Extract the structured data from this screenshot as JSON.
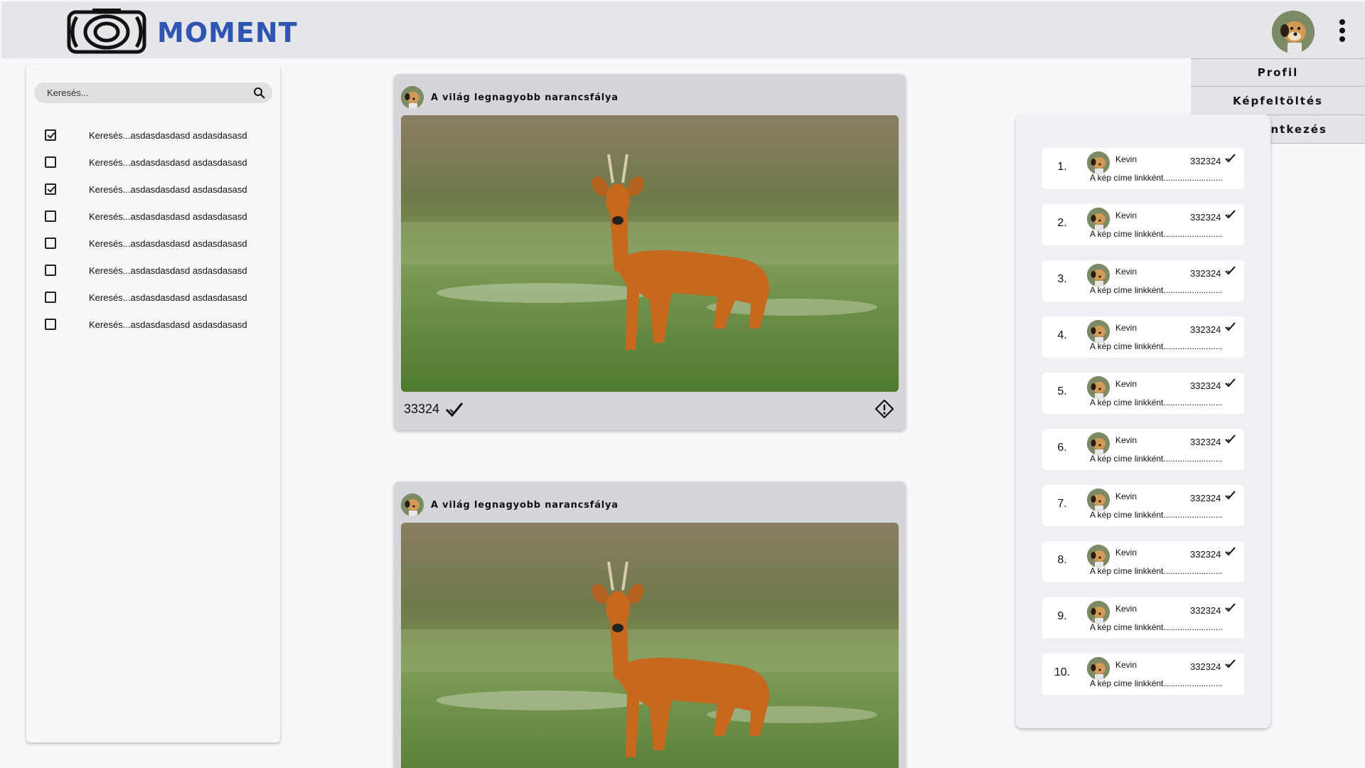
{
  "app": {
    "name": "MOMENT"
  },
  "colors": {
    "brand": "#2f55b0",
    "header_bg": "#e5e6e9",
    "card_bg": "#d4d6da"
  },
  "menu": {
    "items": [
      {
        "label": "Profil"
      },
      {
        "label": "Képfeltöltés"
      },
      {
        "label": "Kijelentkezés"
      }
    ]
  },
  "sidebar": {
    "search": {
      "placeholder": "Keresés..."
    },
    "filters": [
      {
        "label": "Keresés...asdasdasdasd asdasdasasd",
        "checked": true
      },
      {
        "label": "Keresés...asdasdasdasd asdasdasasd",
        "checked": false
      },
      {
        "label": "Keresés...asdasdasdasd asdasdasasd",
        "checked": true
      },
      {
        "label": "Keresés...asdasdasdasd asdasdasasd",
        "checked": false
      },
      {
        "label": "Keresés...asdasdasdasd asdasdasasd",
        "checked": false
      },
      {
        "label": "Keresés...asdasdasdasd asdasdasasd",
        "checked": false
      },
      {
        "label": "Keresés...asdasdasdasd asdasdasasd",
        "checked": false
      },
      {
        "label": "Keresés...asdasdasdasd asdasdasasd",
        "checked": false
      }
    ]
  },
  "posts": [
    {
      "title": "A világ legnagyobb narancsfálya",
      "count": "33324"
    },
    {
      "title": "A világ legnagyobb narancsfálya",
      "count": ""
    }
  ],
  "leaderboard": {
    "entries": [
      {
        "rank": "1.",
        "name": "Kevin",
        "score": "332324",
        "caption": "A kép címe linkként........................."
      },
      {
        "rank": "2.",
        "name": "Kevin",
        "score": "332324",
        "caption": "A kép címe linkként........................."
      },
      {
        "rank": "3.",
        "name": "Kevin",
        "score": "332324",
        "caption": "A kép címe linkként........................."
      },
      {
        "rank": "4.",
        "name": "Kevin",
        "score": "332324",
        "caption": "A kép címe linkként........................."
      },
      {
        "rank": "5.",
        "name": "Kevin",
        "score": "332324",
        "caption": "A kép címe linkként........................."
      },
      {
        "rank": "6.",
        "name": "Kevin",
        "score": "332324",
        "caption": "A kép címe linkként........................."
      },
      {
        "rank": "7.",
        "name": "Kevin",
        "score": "332324",
        "caption": "A kép címe linkként........................."
      },
      {
        "rank": "8.",
        "name": "Kevin",
        "score": "332324",
        "caption": "A kép címe linkként........................."
      },
      {
        "rank": "9.",
        "name": "Kevin",
        "score": "332324",
        "caption": "A kép címe linkként........................."
      },
      {
        "rank": "10.",
        "name": "Kevin",
        "score": "332324",
        "caption": "A kép címe linkként........................."
      }
    ]
  }
}
